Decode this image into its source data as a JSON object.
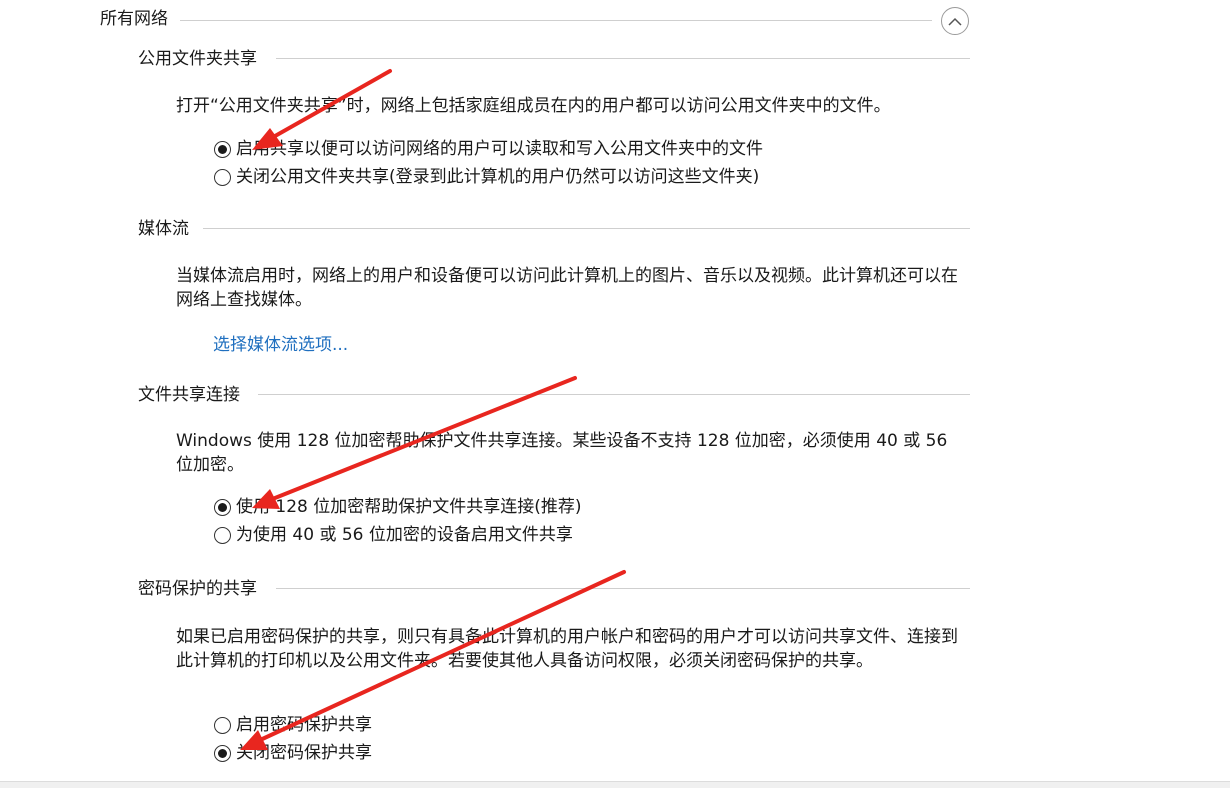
{
  "all_networks": {
    "title": "所有网络"
  },
  "sections": [
    {
      "title": "公用文件夹共享",
      "description": "打开“公用文件夹共享”时，网络上包括家庭组成员在内的用户都可以访问公用文件夹中的文件。",
      "options": [
        {
          "label": "启用共享以便可以访问网络的用户可以读取和写入公用文件夹中的文件",
          "selected": true
        },
        {
          "label": "关闭公用文件夹共享(登录到此计算机的用户仍然可以访问这些文件夹)",
          "selected": false
        }
      ]
    },
    {
      "title": "媒体流",
      "description": "当媒体流启用时，网络上的用户和设备便可以访问此计算机上的图片、音乐以及视频。此计算机还可以在网络上查找媒体。",
      "link": "选择媒体流选项..."
    },
    {
      "title": "文件共享连接",
      "description": "Windows 使用 128 位加密帮助保护文件共享连接。某些设备不支持 128 位加密，必须使用 40 或 56 位加密。",
      "options": [
        {
          "label": "使用 128 位加密帮助保护文件共享连接(推荐)",
          "selected": true
        },
        {
          "label": "为使用 40 或 56 位加密的设备启用文件共享",
          "selected": false
        }
      ]
    },
    {
      "title": "密码保护的共享",
      "description": "如果已启用密码保护的共享，则只有具备此计算机的用户帐户和密码的用户才可以访问共享文件、连接到此计算机的打印机以及公用文件夹。若要使其他人具备访问权限，必须关闭密码保护的共享。",
      "options": [
        {
          "label": "启用密码保护共享",
          "selected": false
        },
        {
          "label": "关闭密码保护共享",
          "selected": true
        }
      ]
    }
  ],
  "icons": {
    "collapse": "chevron-up-icon",
    "annotation": "red-arrow-icon"
  },
  "colors": {
    "link": "#1f6fbf",
    "annotation_arrow": "#e8261f"
  }
}
